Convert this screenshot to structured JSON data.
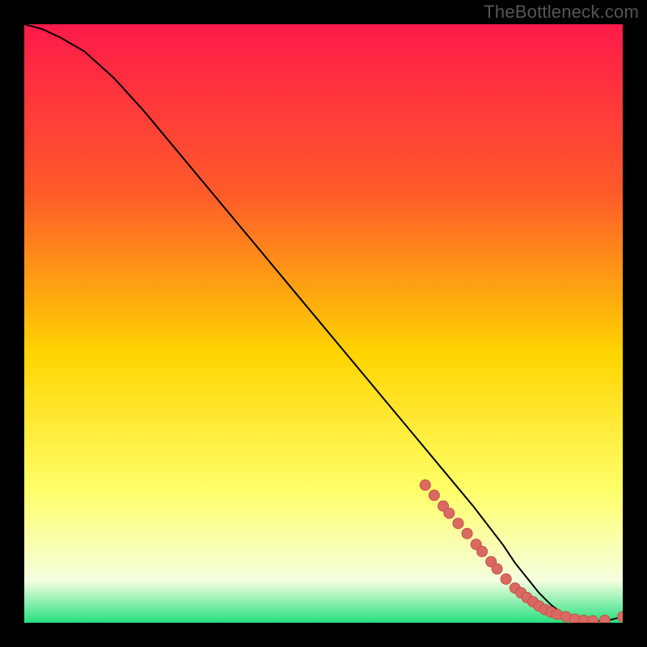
{
  "watermark": {
    "text": "TheBottleneck.com"
  },
  "colors": {
    "background": "#000000",
    "gradient_top": "#ff1a4a",
    "gradient_upper": "#ff5a2a",
    "gradient_mid": "#ffd400",
    "gradient_lower": "#ffff6a",
    "gradient_pale": "#f5ffe0",
    "gradient_green": "#26e07f",
    "curve": "#000000",
    "marker_fill": "#d96a62",
    "marker_stroke": "#c95048"
  },
  "chart_data": {
    "type": "line",
    "title": "",
    "xlabel": "",
    "ylabel": "",
    "xlim": [
      0,
      100
    ],
    "ylim": [
      0,
      100
    ],
    "series": [
      {
        "name": "curve",
        "x": [
          0,
          3,
          6,
          10,
          15,
          20,
          25,
          30,
          35,
          40,
          45,
          50,
          55,
          60,
          65,
          70,
          75,
          80,
          82,
          84,
          86,
          88,
          90,
          92,
          94,
          96,
          98,
          100
        ],
        "y": [
          100,
          99.2,
          97.8,
          95.5,
          91.0,
          85.5,
          79.5,
          73.5,
          67.5,
          61.5,
          55.5,
          49.5,
          43.5,
          37.5,
          31.5,
          25.5,
          19.5,
          13.0,
          10.0,
          7.5,
          5.0,
          3.0,
          1.5,
          0.6,
          0.3,
          0.3,
          0.5,
          1.0
        ]
      }
    ],
    "markers": {
      "name": "highlighted-points",
      "x": [
        67,
        68.5,
        70,
        71,
        72.5,
        74,
        75.5,
        76.5,
        78,
        79,
        80.5,
        82,
        83,
        84,
        85,
        86,
        87,
        88,
        89,
        90.5,
        92,
        93.5,
        95,
        97,
        100
      ],
      "y": [
        23.0,
        21.3,
        19.5,
        18.3,
        16.6,
        14.9,
        13.1,
        11.9,
        10.2,
        9.0,
        7.3,
        5.8,
        5.0,
        4.2,
        3.5,
        2.8,
        2.2,
        1.8,
        1.4,
        1.0,
        0.6,
        0.4,
        0.3,
        0.4,
        1.0
      ]
    }
  }
}
